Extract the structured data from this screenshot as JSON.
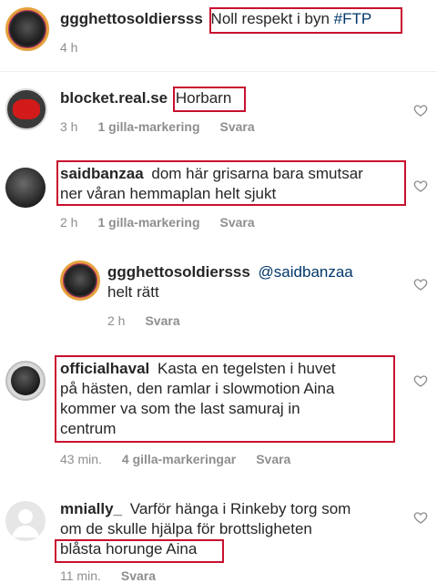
{
  "comments": [
    {
      "user": "ggghettosoldiersss",
      "text": "Noll respekt i byn ",
      "hashtag": "#FTP",
      "time": "4 h"
    },
    {
      "user": "blocket.real.se",
      "text": "Horbarn",
      "time": "3 h",
      "likes": "1 gilla-markering",
      "reply": "Svara"
    },
    {
      "user": "saidbanzaa",
      "text_line1": "dom här grisarna bara smutsar",
      "text_line2": "ner våran hemmaplan helt sjukt",
      "time": "2 h",
      "likes": "1 gilla-markering",
      "reply": "Svara"
    },
    {
      "user": "ggghettosoldiersss",
      "mention": "@saidbanzaa",
      "text": "helt rätt",
      "time": "2 h",
      "reply": "Svara"
    },
    {
      "user": "officialhaval",
      "text_line1": "Kasta en tegelsten i huvet",
      "text_line2": "på hästen, den ramlar i slowmotion Aina",
      "text_line3": "kommer va som the last samuraj in",
      "text_line4": "centrum",
      "time": "43 min.",
      "likes": "4 gilla-markeringar",
      "reply": "Svara"
    },
    {
      "user": "mnially_",
      "text_line1": "Varför hänga i Rinkeby torg som",
      "text_line2": "om de skulle hjälpa för brottsligheten",
      "text_line3": "blåsta horunge Aina",
      "time": "11 min.",
      "reply": "Svara"
    }
  ],
  "icons": {
    "like": "heart-outline-icon"
  },
  "colors": {
    "highlight_box": "#c8102e",
    "meta_gray": "#8e8e8e",
    "mention_blue": "#00376b"
  }
}
